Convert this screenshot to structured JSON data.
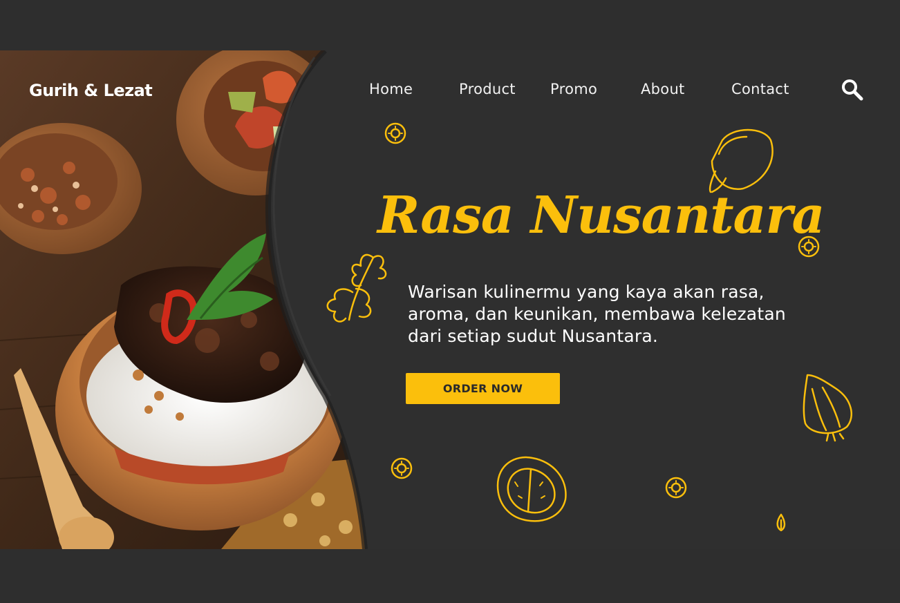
{
  "header": {
    "brand": "Gurih & Lezat",
    "nav": [
      {
        "label": "Home"
      },
      {
        "label": "Product"
      },
      {
        "label": "Promo"
      },
      {
        "label": "About"
      },
      {
        "label": "Contact"
      }
    ],
    "search_icon": "search-icon"
  },
  "hero": {
    "headline": "Rasa Nusantara",
    "tagline_lines": [
      "Warisan kulinermu yang kaya akan rasa,",
      "aroma, dan keunikan, membawa kelezatan",
      "dari setiap sudut Nusantara."
    ],
    "cta_label": "ORDER NOW"
  },
  "colors": {
    "background": "#2f2f2f",
    "accent": "#fbbf0c",
    "text": "#ffffff"
  }
}
